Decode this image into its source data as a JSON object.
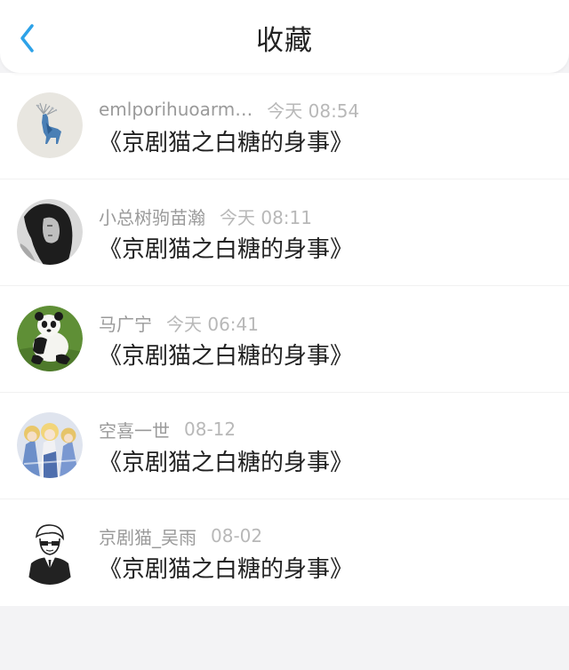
{
  "header": {
    "title": "收藏",
    "back_icon": "chevron-left-icon",
    "accent_color": "#2da2e8"
  },
  "items": [
    {
      "avatar_icon": "deer-illustration-avatar",
      "user": "emlporihuoarm…",
      "time": "今天 08:54",
      "title": "《京剧猫之白糖的身事》"
    },
    {
      "avatar_icon": "girl-photo-avatar",
      "user": "小总树驹苗瀚",
      "time": "今天 08:11",
      "title": "《京剧猫之白糖的身事》"
    },
    {
      "avatar_icon": "panda-avatar",
      "user": "马广宁",
      "time": "今天 06:41",
      "title": "《京剧猫之白糖的身事》"
    },
    {
      "avatar_icon": "anime-characters-avatar",
      "user": "空喜一世",
      "time": "08-12",
      "title": "《京剧猫之白糖的身事》"
    },
    {
      "avatar_icon": "cartoon-man-avatar",
      "user": "京剧猫_吴雨",
      "time": "08-02",
      "title": "《京剧猫之白糖的身事》"
    }
  ]
}
